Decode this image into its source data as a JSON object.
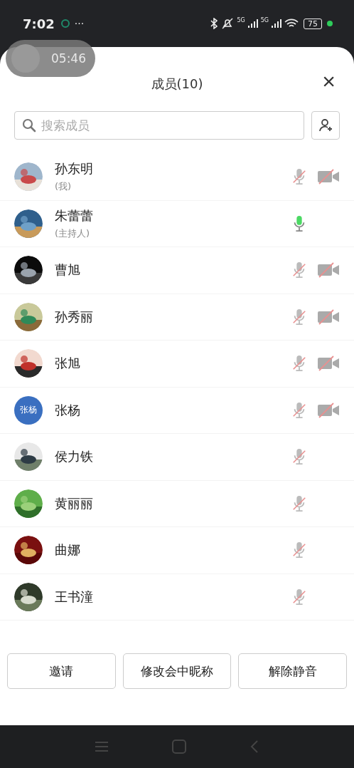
{
  "status_bar": {
    "time": "7:02",
    "more": "···",
    "network_1": "5G",
    "network_2": "5G",
    "battery": "75"
  },
  "call_timer": "05:46",
  "sheet": {
    "title": "成员(10)",
    "close": "×"
  },
  "search": {
    "placeholder": "搜索成员"
  },
  "members": [
    {
      "name": "孙东明",
      "role": "(我)",
      "mic_muted": true,
      "camera_off": true
    },
    {
      "name": "朱蕾蕾",
      "role": "(主持人)",
      "mic_muted": false
    },
    {
      "name": "曹旭",
      "mic_muted": true,
      "camera_off": true
    },
    {
      "name": "孙秀丽",
      "mic_muted": true,
      "camera_off": true
    },
    {
      "name": "张旭",
      "mic_muted": true,
      "camera_off": true
    },
    {
      "name": "张杨",
      "avatar": {
        "kind": "initials",
        "text": "张杨",
        "color": "#3a6fc0"
      },
      "mic_muted": true,
      "camera_off": true
    },
    {
      "name": "侯力铁",
      "mic_muted": true
    },
    {
      "name": "黄丽丽",
      "mic_muted": true
    },
    {
      "name": "曲娜",
      "mic_muted": true
    },
    {
      "name": "王书潼",
      "mic_muted": true
    }
  ],
  "buttons": [
    "邀请",
    "修改会中昵称",
    "解除静音"
  ]
}
